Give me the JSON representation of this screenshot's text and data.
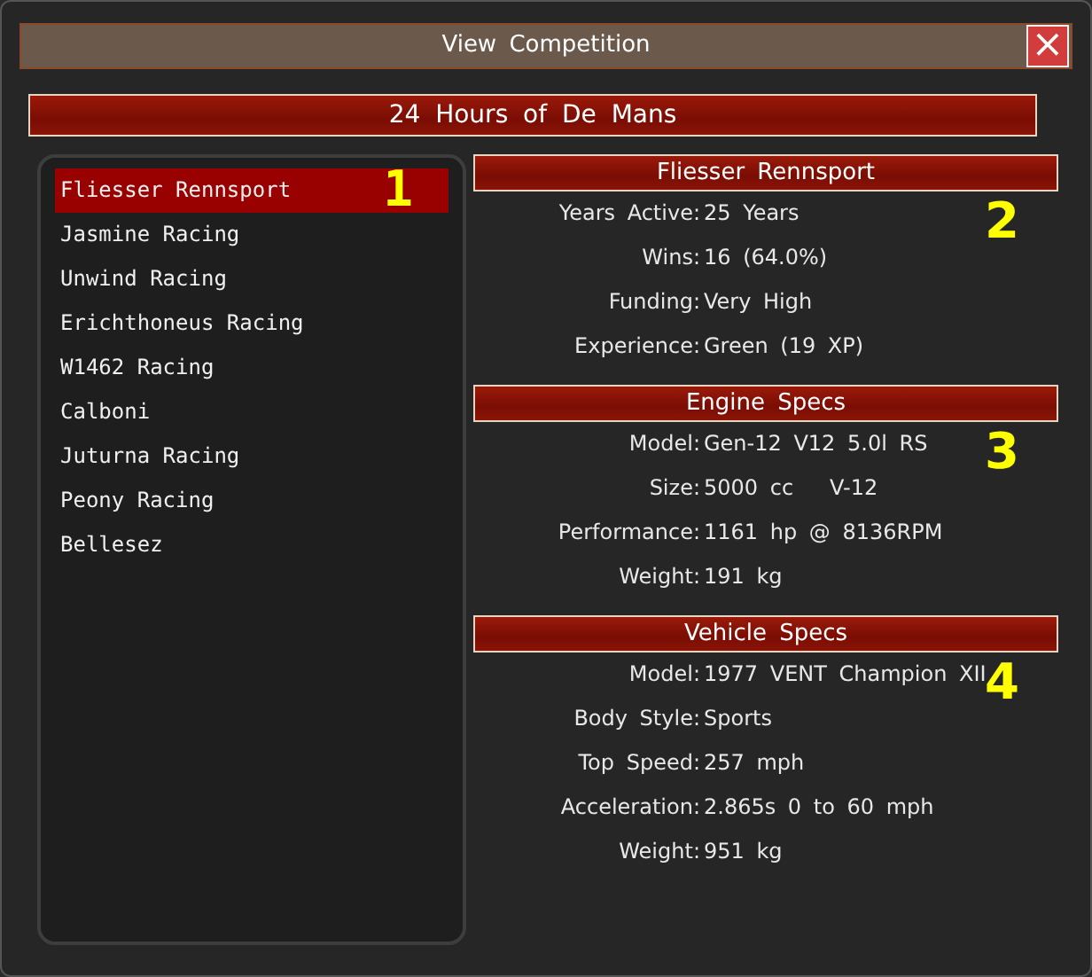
{
  "window": {
    "title": "View Competition",
    "close": "×"
  },
  "competition": "24 Hours of De Mans",
  "teams": [
    {
      "name": "Fliesser Rennsport",
      "selected": true,
      "marker": "1"
    },
    {
      "name": "Jasmine Racing",
      "selected": false
    },
    {
      "name": "Unwind Racing",
      "selected": false
    },
    {
      "name": "Erichthoneus Racing",
      "selected": false
    },
    {
      "name": "W1462 Racing",
      "selected": false
    },
    {
      "name": "Calboni",
      "selected": false
    },
    {
      "name": "Juturna Racing",
      "selected": false
    },
    {
      "name": "Peony Racing",
      "selected": false
    },
    {
      "name": "Bellesez",
      "selected": false
    }
  ],
  "sections": [
    {
      "title": "Fliesser Rennsport",
      "marker": "2",
      "fields": [
        {
          "label": "Years Active:",
          "value": "25 Years"
        },
        {
          "label": "Wins:",
          "value": "16 (64.0%)"
        },
        {
          "label": "Funding:",
          "value": "Very High"
        },
        {
          "label": "Experience:",
          "value": "Green (19 XP)"
        }
      ]
    },
    {
      "title": "Engine Specs",
      "marker": "3",
      "fields": [
        {
          "label": "Model:",
          "value": "Gen-12 V12 5.0l RS"
        },
        {
          "label": "Size:",
          "value": "5000 cc   V-12"
        },
        {
          "label": "Performance:",
          "value": "1161 hp @ 8136RPM"
        },
        {
          "label": "Weight:",
          "value": "191 kg"
        }
      ]
    },
    {
      "title": "Vehicle Specs",
      "marker": "4",
      "fields": [
        {
          "label": "Model:",
          "value": "1977 VENT Champion XII"
        },
        {
          "label": "Body Style:",
          "value": "Sports"
        },
        {
          "label": "Top Speed:",
          "value": "257 mph"
        },
        {
          "label": "Acceleration:",
          "value": "2.865s 0 to 60 mph"
        },
        {
          "label": "Weight:",
          "value": "951 kg"
        }
      ]
    }
  ]
}
